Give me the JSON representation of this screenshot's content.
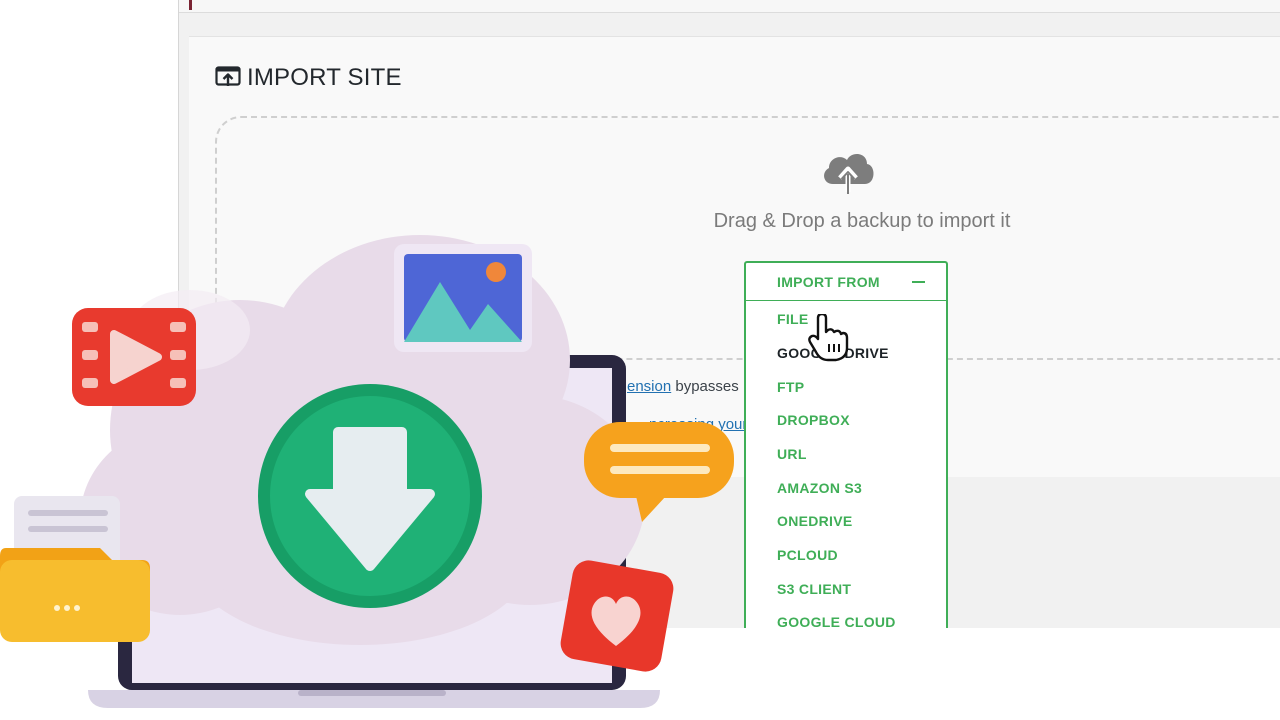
{
  "page": {
    "title": "IMPORT SITE",
    "dropzone_text": "Drag & Drop a backup to import it",
    "helper_link_1": "ension",
    "helper_text_1_suffix": " bypasses",
    "helper_link_2": "ncreasing your up"
  },
  "import_menu": {
    "header_label": "IMPORT FROM",
    "items": [
      {
        "label": "FILE"
      },
      {
        "label": "GOOGLE DRIVE"
      },
      {
        "label": "FTP"
      },
      {
        "label": "DROPBOX"
      },
      {
        "label": "URL"
      },
      {
        "label": "AMAZON S3"
      },
      {
        "label": "ONEDRIVE"
      },
      {
        "label": "PCLOUD"
      },
      {
        "label": "S3 CLIENT"
      },
      {
        "label": "GOOGLE CLOUD"
      }
    ]
  },
  "colors": {
    "accent_green": "#3fae57",
    "download_green": "#1aa56b",
    "cloud": "#e8dbe9"
  },
  "icons": [
    "import-icon",
    "cloud-upload-icon",
    "minus-icon",
    "hand-cursor-icon",
    "video-icon",
    "image-icon",
    "download-icon",
    "chat-icon",
    "heart-icon",
    "folder-icon",
    "laptop-icon"
  ]
}
